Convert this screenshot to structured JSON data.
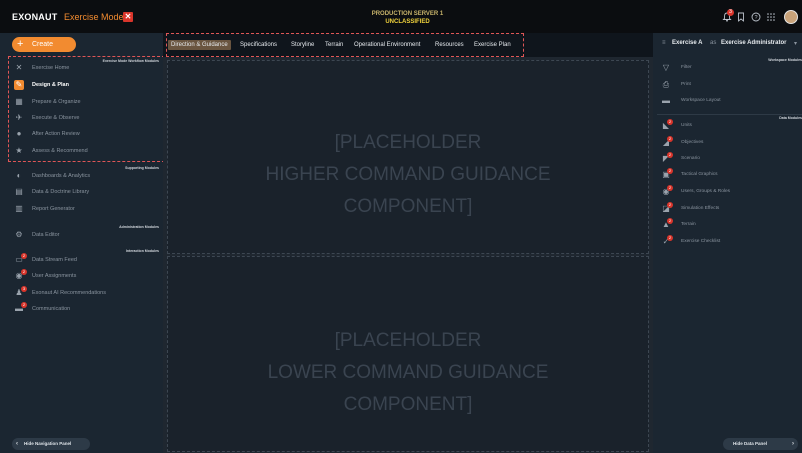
{
  "header": {
    "brand": "EXONAUT",
    "mode": "Exercise Mode",
    "mode_close": "✕",
    "server": "PRODUCTION SERVER 1",
    "classification": "UNCLASSIFIED",
    "notification_count": "3"
  },
  "left_nav": {
    "create_label": "Create",
    "create_icon": "+",
    "sections": {
      "workflow": "Exercise Mode Workflow Modules",
      "supporting": "Supporting Modules",
      "administration": "Administration Modules",
      "interaction": "Interaction Modules"
    },
    "workflow_items": [
      {
        "label": "Exercise Home",
        "icon": "home-icon"
      },
      {
        "label": "Design & Plan",
        "icon": "pencil-icon"
      },
      {
        "label": "Prepare & Organize",
        "icon": "calendar-icon"
      },
      {
        "label": "Execute & Observe",
        "icon": "run-icon"
      },
      {
        "label": "After Action Review",
        "icon": "bulb-icon"
      },
      {
        "label": "Assess & Recommend",
        "icon": "star-icon"
      }
    ],
    "supporting_items": [
      {
        "label": "Dashboards & Analytics",
        "icon": "chart-icon"
      },
      {
        "label": "Data & Doctrine Library",
        "icon": "library-icon"
      },
      {
        "label": "Report Generator",
        "icon": "report-icon"
      }
    ],
    "admin_items": [
      {
        "label": "Data Editor",
        "icon": "gear-icon"
      }
    ],
    "interaction_items": [
      {
        "label": "Data Stream Feed",
        "icon": "feed-icon",
        "badge": "2"
      },
      {
        "label": "User Assignments",
        "icon": "user-icon",
        "badge": "2"
      },
      {
        "label": "Exonaut AI Recommendations",
        "icon": "ai-icon",
        "badge": "3"
      },
      {
        "label": "Communication",
        "icon": "chat-icon",
        "badge": "2"
      }
    ],
    "hide_label": "Hide Navigation Panel"
  },
  "tabs": [
    "Direction & Guidance",
    "Specifications",
    "Storyline",
    "Terrain",
    "Operational Environment",
    "Resources",
    "Exercise Plan"
  ],
  "active_tab": "Direction & Guidance",
  "main": {
    "upper_placeholder": [
      "[PLACEHOLDER",
      "HIGHER COMMAND GUIDANCE",
      "COMPONENT]"
    ],
    "lower_placeholder": [
      "[PLACEHOLDER",
      "LOWER COMMAND GUIDANCE",
      "COMPONENT]"
    ]
  },
  "right_panel": {
    "exercise": "Exercise A",
    "separator_1": "≡",
    "role": "Exercise Administrator",
    "role_chevron": "▾",
    "separator_2": "as",
    "workspace_header": "Workspace Modules",
    "workspace_items": [
      {
        "label": "Filter",
        "icon": "filter-icon"
      },
      {
        "label": "Print",
        "icon": "print-icon"
      },
      {
        "label": "Workspace Layout",
        "icon": "layout-icon"
      }
    ],
    "data_header": "Data Modules",
    "data_items": [
      {
        "label": "Units",
        "icon": "unit-icon",
        "badge": "2"
      },
      {
        "label": "Objectives",
        "icon": "objective-icon",
        "badge": "2"
      },
      {
        "label": "Scenario",
        "icon": "scenario-icon",
        "badge": "2"
      },
      {
        "label": "Tactical Graphics",
        "icon": "graphics-icon",
        "badge": "2"
      },
      {
        "label": "Users, Groups & Roles",
        "icon": "users-icon",
        "badge": "2"
      },
      {
        "label": "Simulation Effects",
        "icon": "effects-icon",
        "badge": "2"
      },
      {
        "label": "Terrain",
        "icon": "terrain-icon",
        "badge": "2"
      },
      {
        "label": "Exercise Checklist",
        "icon": "checklist-icon",
        "badge": "2"
      }
    ],
    "hide_label": "Hide Data Panel"
  },
  "colors": {
    "accent": "#f28b30",
    "badge": "#d9352b",
    "highlight_dash": "#e05656",
    "classification": "#f0d23c"
  }
}
